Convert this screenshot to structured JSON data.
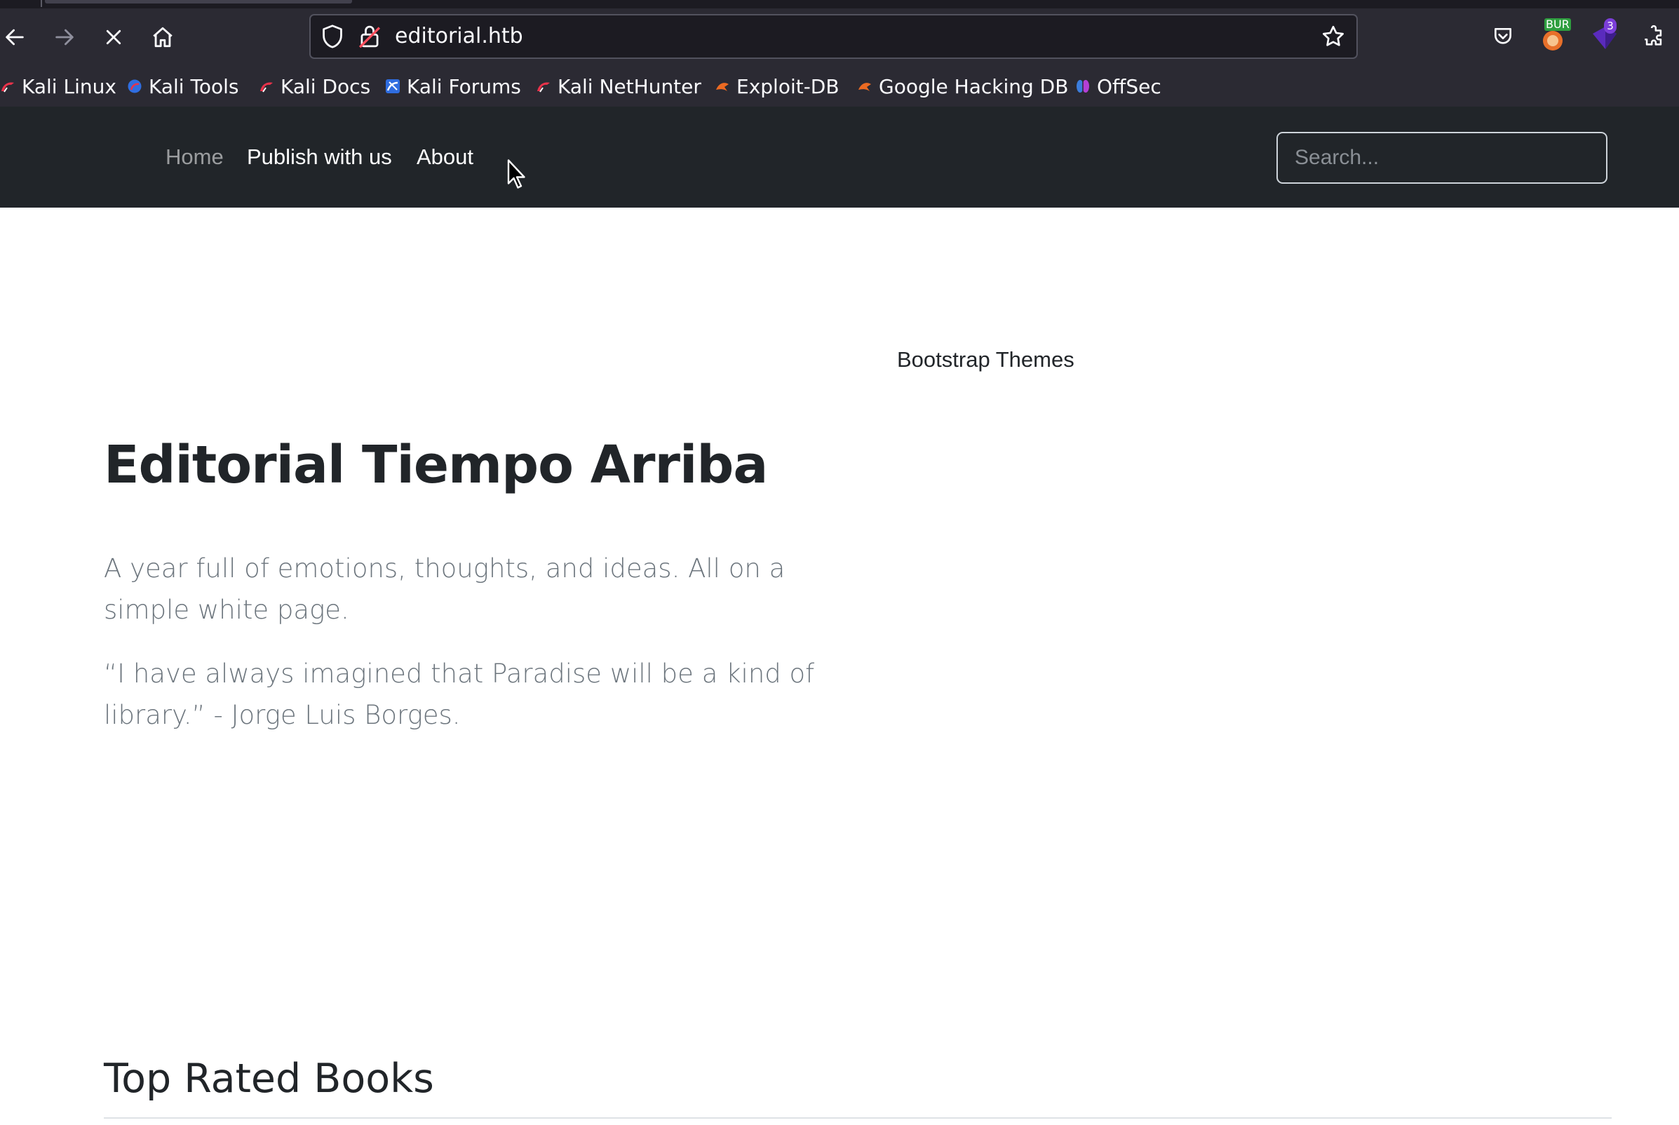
{
  "browser": {
    "url": "editorial.htb",
    "bookmarks": [
      {
        "label": "Kali Linux",
        "icon": "kali-dragon-icon"
      },
      {
        "label": "Kali Tools",
        "icon": "kali-tools-icon"
      },
      {
        "label": "Kali Docs",
        "icon": "kali-dragon-icon"
      },
      {
        "label": "Kali Forums",
        "icon": "kali-forums-icon"
      },
      {
        "label": "Kali NetHunter",
        "icon": "kali-dragon-icon"
      },
      {
        "label": "Exploit-DB",
        "icon": "exploit-db-icon"
      },
      {
        "label": "Google Hacking DB",
        "icon": "exploit-db-icon"
      },
      {
        "label": "OffSec",
        "icon": "offsec-icon"
      }
    ],
    "extensions": {
      "burp_badge": "BUR",
      "notification_count": "3"
    }
  },
  "site": {
    "nav": {
      "home": "Home",
      "publish": "Publish with us",
      "about": "About"
    },
    "search": {
      "placeholder": "Search..."
    },
    "hero": {
      "image_alt": "Bootstrap Themes",
      "title": "Editorial Tiempo Arriba",
      "lead1": "A year full of emotions, thoughts, and ideas. All on a simple white page.",
      "lead2": "“I have always imagined that Paradise will be a kind of library.” - Jorge Luis Borges."
    },
    "section_title": "Top Rated Books"
  }
}
